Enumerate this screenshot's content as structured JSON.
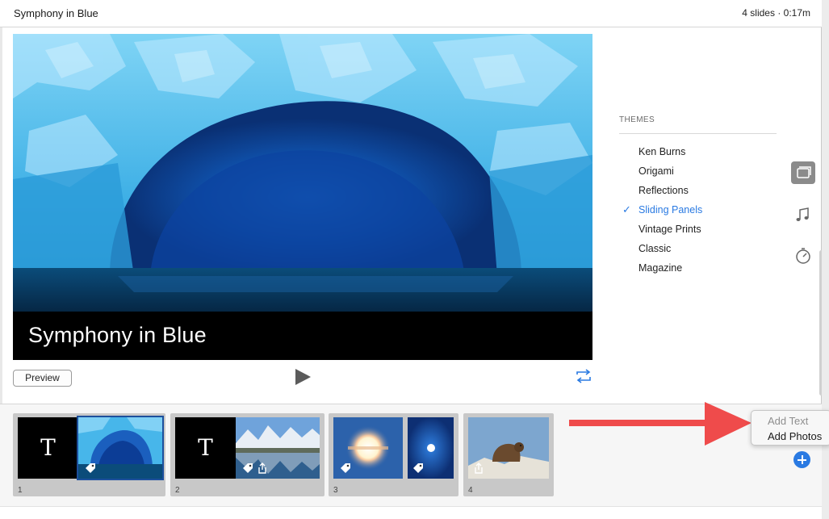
{
  "window": {
    "title": "Symphony in Blue",
    "meta": "4 slides · 0:17m"
  },
  "preview": {
    "caption": "Symphony in Blue",
    "preview_button_label": "Preview",
    "play_icon": "play-icon",
    "loop_icon": "loop-icon"
  },
  "themes": {
    "header": "THEMES",
    "items": [
      {
        "label": "Ken Burns",
        "selected": false
      },
      {
        "label": "Origami",
        "selected": false
      },
      {
        "label": "Reflections",
        "selected": false
      },
      {
        "label": "Sliding Panels",
        "selected": true
      },
      {
        "label": "Vintage Prints",
        "selected": false
      },
      {
        "label": "Classic",
        "selected": false
      },
      {
        "label": "Magazine",
        "selected": false
      }
    ],
    "selected_color": "#2a7ae2",
    "check_glyph": "✓"
  },
  "side_tools": [
    {
      "icon": "themes-icon",
      "active": true
    },
    {
      "icon": "music-note-icon",
      "active": false
    },
    {
      "icon": "duration-timer-icon",
      "active": false
    }
  ],
  "slides": [
    {
      "number": "1",
      "title_glyph": "T"
    },
    {
      "number": "2",
      "title_glyph": "T"
    },
    {
      "number": "3"
    },
    {
      "number": "4"
    }
  ],
  "add_menu": {
    "items": [
      {
        "label": "Add Text",
        "enabled": false
      },
      {
        "label": "Add Photos",
        "enabled": true
      }
    ]
  },
  "colors": {
    "accent": "#2a7ae2",
    "annotation_arrow": "#ef4b4b",
    "selection_outline": "#1c4f9c"
  }
}
